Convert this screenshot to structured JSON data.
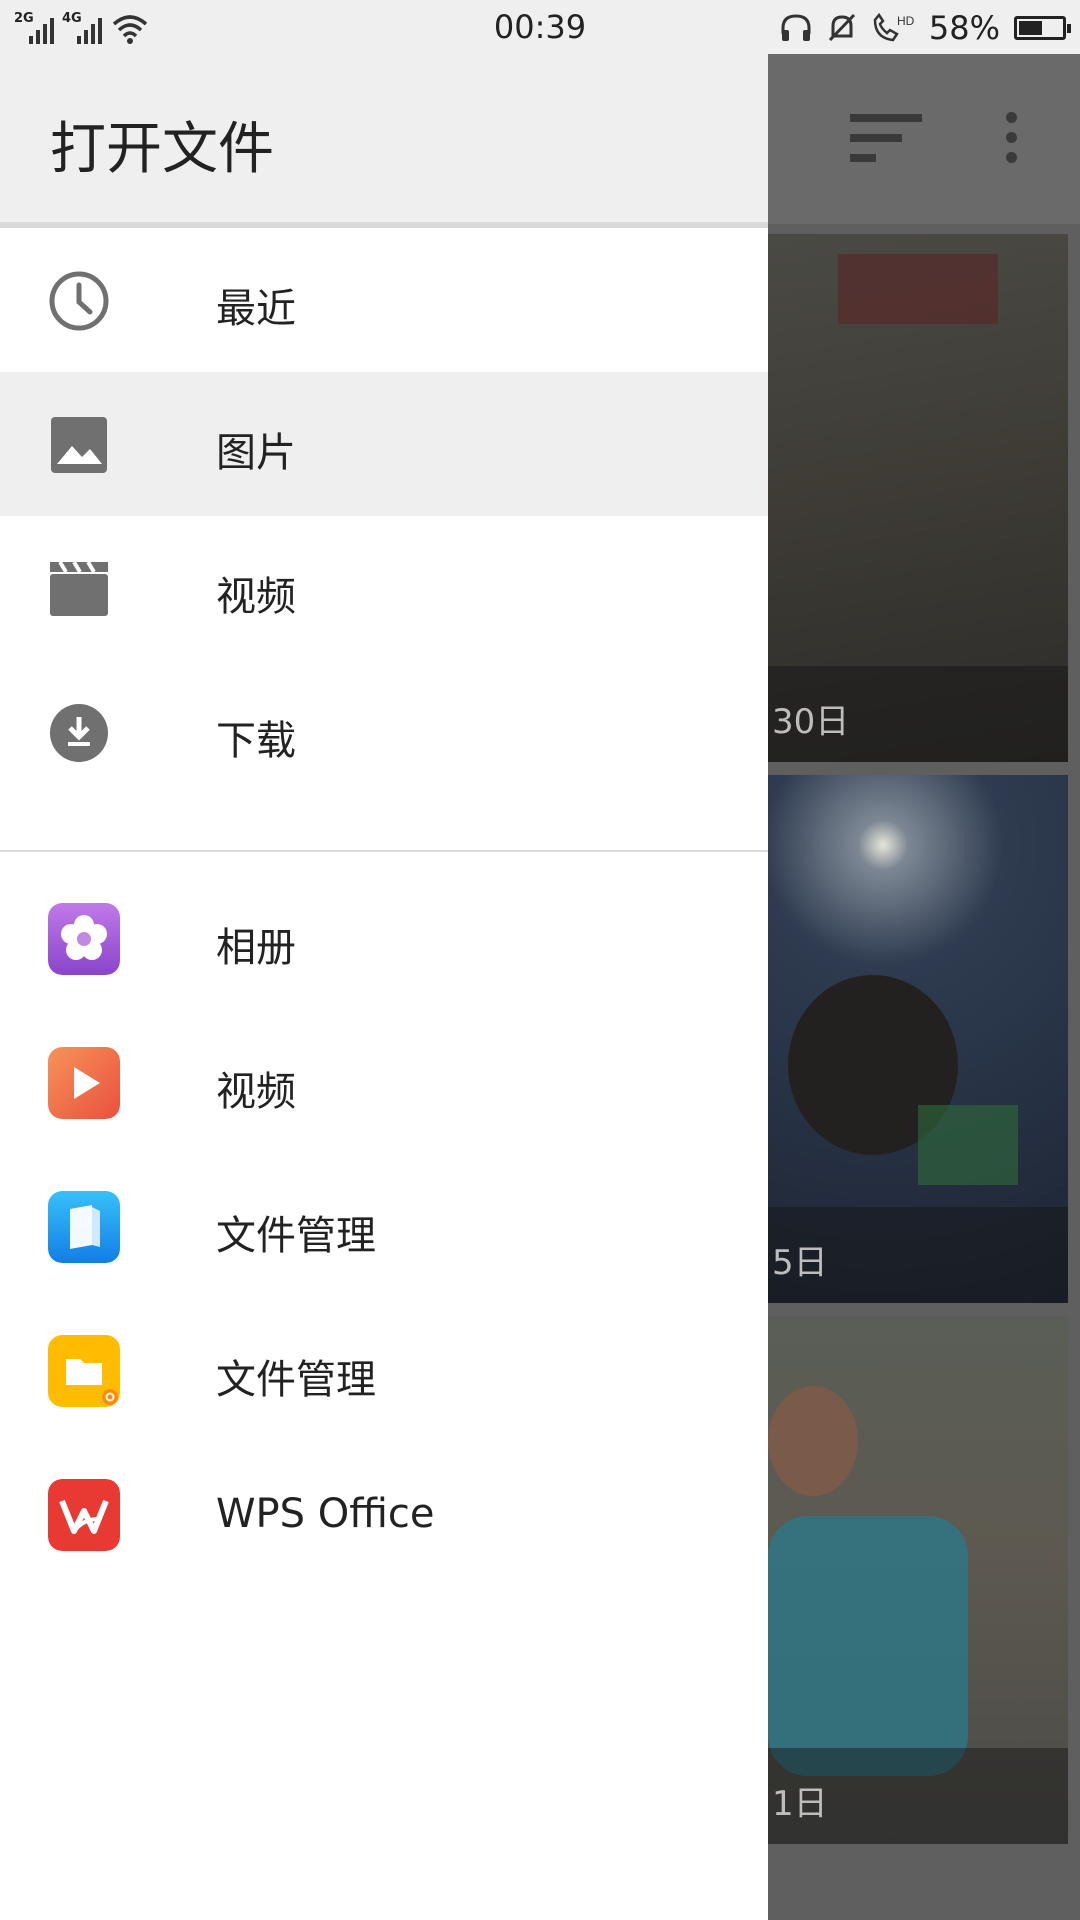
{
  "status_bar": {
    "signal1_label": "2G",
    "signal2_label": "4G",
    "time": "00:39",
    "battery_pct": "58%",
    "battery_level": 0.58
  },
  "drawer": {
    "title": "打开文件",
    "items": [
      {
        "label": "最近",
        "icon": "clock-icon"
      },
      {
        "label": "图片",
        "icon": "image-icon",
        "selected": true
      },
      {
        "label": "视频",
        "icon": "video-clapper-icon"
      },
      {
        "label": "下载",
        "icon": "download-icon"
      }
    ],
    "apps": [
      {
        "label": "相册",
        "icon": "gallery-app-icon",
        "color": "#a05ed8"
      },
      {
        "label": "视频",
        "icon": "video-app-icon",
        "color": "#f06a45"
      },
      {
        "label": "文件管理",
        "icon": "file-manager-blue-app-icon",
        "color": "#1e9ff0"
      },
      {
        "label": "文件管理",
        "icon": "file-manager-yellow-app-icon",
        "color": "#ffbc00"
      },
      {
        "label": "WPS Office",
        "icon": "wps-office-app-icon",
        "color": "#e83a32"
      }
    ]
  },
  "background": {
    "photo_captions": [
      "30日",
      "5日",
      "1日"
    ]
  }
}
